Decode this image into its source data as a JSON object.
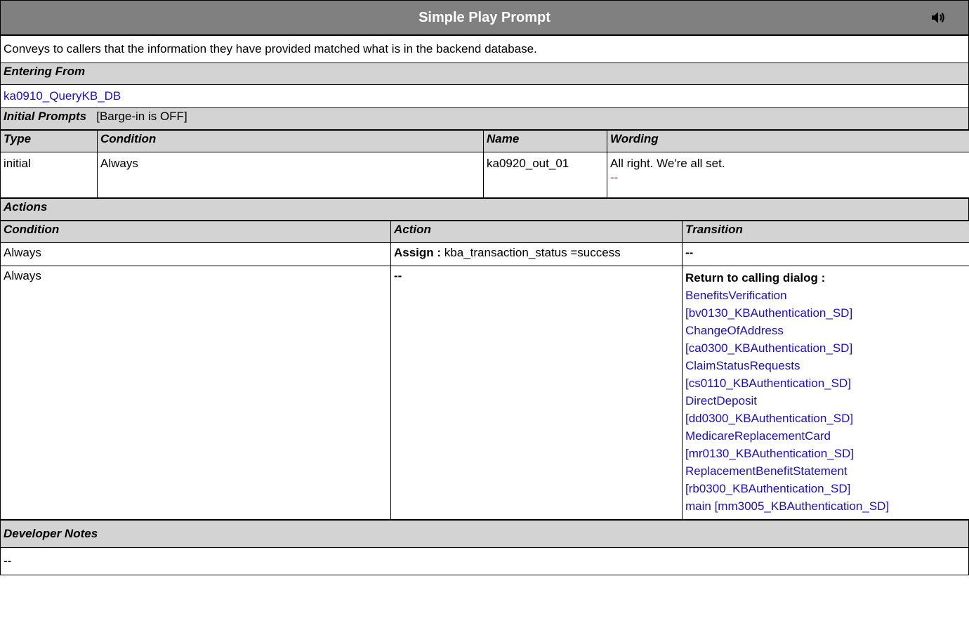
{
  "title": "Simple Play Prompt",
  "description": "Conveys to callers that the information they have provided matched what is in the backend database.",
  "entering_from": {
    "heading": "Entering From",
    "link": "ka0910_QueryKB_DB"
  },
  "initial_prompts": {
    "heading": "Initial Prompts",
    "barge_in": "[Barge-in is OFF]",
    "columns": {
      "type": "Type",
      "condition": "Condition",
      "name": "Name",
      "wording": "Wording"
    },
    "rows": [
      {
        "type": "initial",
        "condition": "Always",
        "name": "ka0920_out_01",
        "wording": "All right. We're all set.",
        "wording_link": "--"
      }
    ]
  },
  "actions": {
    "heading": "Actions",
    "columns": {
      "condition": "Condition",
      "action": "Action",
      "transition": "Transition"
    },
    "rows": [
      {
        "condition": "Always",
        "action_label": "Assign :",
        "action_value": "kba_transaction_status =success",
        "transition": "--"
      },
      {
        "condition": "Always",
        "action_value": "--",
        "transition_label": "Return to calling dialog :",
        "transition_links": [
          "BenefitsVerification",
          "[bv0130_KBAuthentication_SD]",
          "ChangeOfAddress",
          "[ca0300_KBAuthentication_SD]",
          "ClaimStatusRequests",
          "[cs0110_KBAuthentication_SD]",
          "DirectDeposit",
          "[dd0300_KBAuthentication_SD]",
          "MedicareReplacementCard",
          "[mr0130_KBAuthentication_SD]",
          "ReplacementBenefitStatement",
          "[rb0300_KBAuthentication_SD]",
          "main [mm3005_KBAuthentication_SD]"
        ]
      }
    ]
  },
  "developer_notes": {
    "heading": "Developer Notes",
    "text": "--"
  },
  "icons": {
    "speaker": "speaker-icon"
  }
}
